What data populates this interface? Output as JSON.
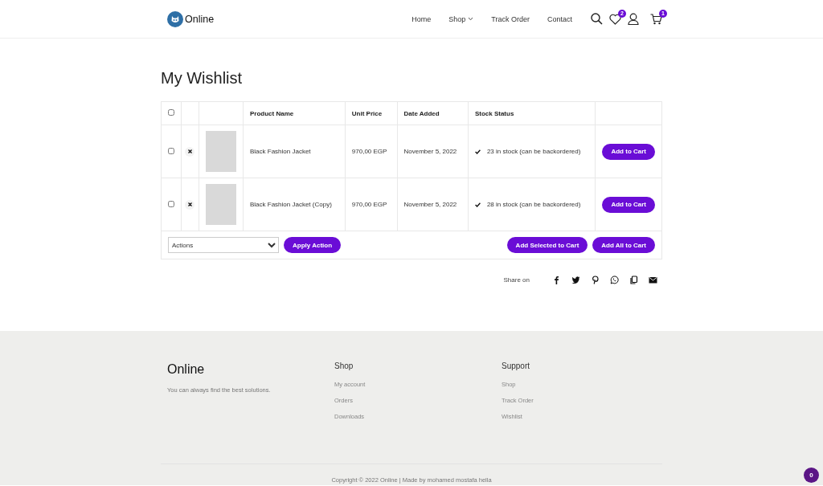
{
  "header": {
    "logo": "Online",
    "nav": [
      {
        "label": "Home",
        "kind": "link"
      },
      {
        "label": "Shop",
        "kind": "dropdown"
      },
      {
        "label": "Track Order",
        "kind": "link"
      },
      {
        "label": "Contact",
        "kind": "link"
      }
    ],
    "wishlist_count": "2",
    "cart_count": "1"
  },
  "title": "My Wishlist",
  "table": {
    "columns": [
      "Product Name",
      "Unit Price",
      "Date Added",
      "Stock Status"
    ],
    "select_all_checked": false,
    "rows": [
      {
        "checked": false,
        "name": "Black Fashion Jacket",
        "price": "970,00 EGP",
        "date": "November 5, 2022",
        "stock": "23 in stock (can be backordered)",
        "button": "Add to Cart"
      },
      {
        "checked": false,
        "name": "Black Fashion Jacket (Copy)",
        "price": "970,00 EGP",
        "date": "November 5, 2022",
        "stock": "28 in stock (can be backordered)",
        "button": "Add to Cart"
      }
    ]
  },
  "actions": {
    "select": "Actions",
    "apply": "Apply Action",
    "add_selected": "Add Selected to Cart",
    "add_all": "Add All to Cart"
  },
  "share": {
    "label": "Share on"
  },
  "footer": {
    "brand": "Online",
    "tagline": "You can always find the best solutions.",
    "columns": [
      {
        "title": "Shop",
        "links": [
          "My account",
          "Orders",
          "Downloads"
        ]
      },
      {
        "title": "Support",
        "links": [
          "Shop",
          "Track Order",
          "Wishlist"
        ]
      }
    ],
    "copyright": "Copyright © 2022 Online | Made by mohamed mostafa hella"
  },
  "floating_badge": "0"
}
